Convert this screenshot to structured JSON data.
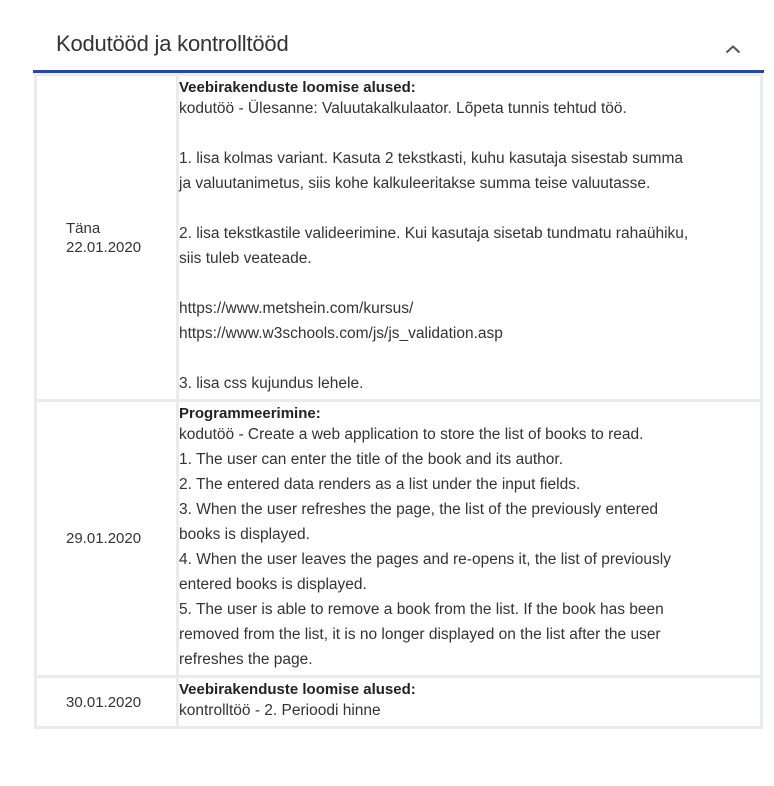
{
  "header": {
    "title": "Kodutööd ja kontrolltööd",
    "collapse_icon": "chevron-up-icon"
  },
  "rows": [
    {
      "date_prefix": "Täna",
      "date": "22.01.2020",
      "subject": "Veebirakenduste loomise alused:",
      "lines": [
        "kodutöö - Ülesanne: Valuutakalkulaator. Lõpeta tunnis tehtud töö.",
        "",
        "1. lisa kolmas variant. Kasuta 2 tekstkasti, kuhu kasutaja sisestab summa",
        "ja valuutanimetus, siis kohe kalkuleeritakse summa teise valuutasse.",
        "",
        "2. lisa tekstkastile valideerimine. Kui kasutaja sisetab tundmatu rahaühiku,",
        "siis tuleb veateade.",
        "",
        "https://www.metshein.com/kursus/",
        "https://www.w3schools.com/js/js_validation.asp",
        "",
        "3. lisa css kujundus lehele."
      ]
    },
    {
      "date_prefix": "",
      "date": "29.01.2020",
      "subject": "Programmeerimine:",
      "lines": [
        "kodutöö - Create a web application to store the list of books to read.",
        "1. The user can enter the title of the book and its author.",
        "2. The entered data renders as a list under the input fields.",
        "3. When the user refreshes the page, the list of the previously entered",
        "books is displayed.",
        "4. When the user leaves the pages and re-opens it, the list of previously",
        "entered books is displayed.",
        "5. The user is able to remove a book from the list. If the book has been",
        "removed from the list, it is no longer displayed on the list after the user",
        "refreshes the page."
      ]
    },
    {
      "date_prefix": "",
      "date": "30.01.2020",
      "subject": "Veebirakenduste loomise alused:",
      "lines": [
        "kontrolltöö - 2. Perioodi hinne"
      ]
    }
  ],
  "colors": {
    "accent": "#27498f",
    "border": "#e9ecef",
    "text": "#333333"
  }
}
